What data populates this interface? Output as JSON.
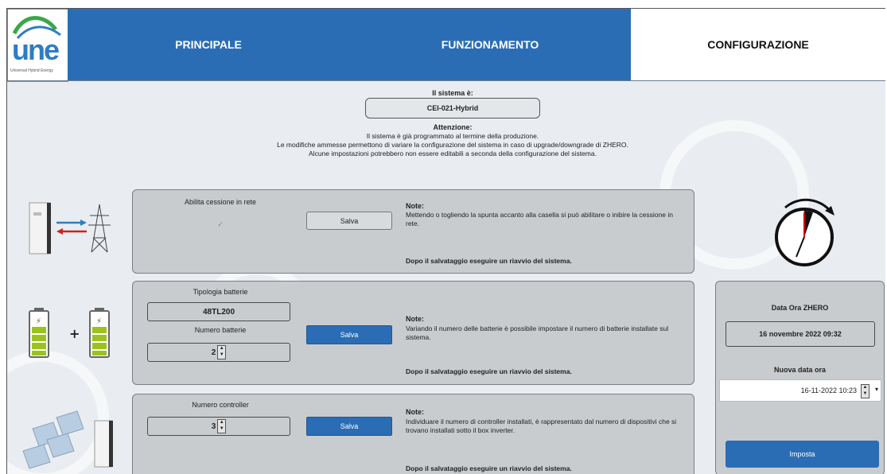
{
  "logo": {
    "text": "une",
    "subtitle": "Universal Hybrid Energy"
  },
  "nav": {
    "tabs": [
      {
        "label": "PRINCIPALE",
        "active": false
      },
      {
        "label": "FUNZIONAMENTO",
        "active": false
      },
      {
        "label": "CONFIGURAZIONE",
        "active": true
      }
    ]
  },
  "system": {
    "heading": "Il sistema è:",
    "value": "CEI-021-Hybrid"
  },
  "warning": {
    "title": "Attenzione:",
    "lines": [
      "Il sistema è già programmato al termine della produzione.",
      "Le modifiche ammesse permettono di variare la configurazione del sistema in caso di upgrade/downgrade di ZHERO.",
      "Alcune impostazioni potrebbero non essere editabili a seconda della configurazione del sistema."
    ]
  },
  "panels": {
    "grid": {
      "label": "Abilita cessione in rete",
      "checkbox_mark": "✓",
      "save_label": "Salva",
      "note_title": "Note:",
      "note_text": "Mettendo o togliendo la spunta accanto alla casella si può abilitare o inibire la cessione in rete.",
      "footer": "Dopo il salvataggio eseguire un riavvio del sistema."
    },
    "battery": {
      "type_label": "Tipologia batterie",
      "type_value": "48TL200",
      "count_label": "Numero batterie",
      "count_value": "2",
      "save_label": "Salva",
      "note_title": "Note:",
      "note_text": "Variando il numero delle batterie è possibile impostare il numero di batterie installate sul sistema.",
      "footer": "Dopo il salvataggio eseguire un riavvio del sistema."
    },
    "controller": {
      "count_label": "Numero controller",
      "count_value": "3",
      "save_label": "Salva",
      "note_title": "Note:",
      "note_text": "Individuare il numero di controller installati, è rappresentato dal numero di dispositivi che si trovano installati sotto il box inverter.",
      "footer": "Dopo il salvataggio eseguire un riavvio del sistema."
    }
  },
  "datetime": {
    "current_label": "Data Ora ZHERO",
    "current_value": "16 novembre 2022 09:32",
    "new_label": "Nuova data ora",
    "new_value": "16-11-2022 10:23",
    "set_label": "Imposta"
  },
  "colors": {
    "brand_blue": "#2a6db5",
    "panel_grey": "#c9cccf",
    "background": "#e9edf1"
  },
  "icons": [
    "inverter-grid-icon",
    "battery-icon",
    "solar-panel-icon",
    "stopwatch-icon"
  ]
}
